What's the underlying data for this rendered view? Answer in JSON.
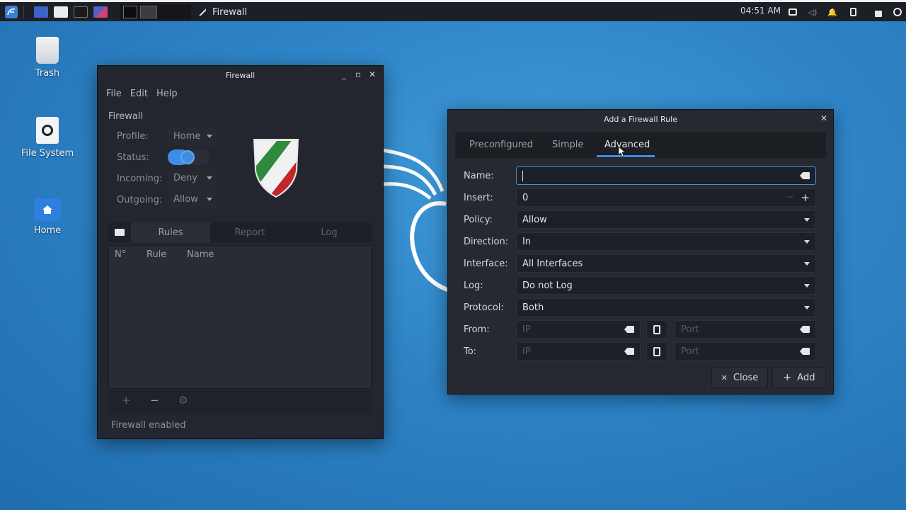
{
  "panel": {
    "active_task": "Firewall",
    "clock": "04:51 AM"
  },
  "desktop": {
    "icons": [
      {
        "label": "Trash"
      },
      {
        "label": "File System"
      },
      {
        "label": "Home"
      }
    ]
  },
  "firewall_window": {
    "title": "Firewall",
    "menu": [
      "File",
      "Edit",
      "Help"
    ],
    "section_title": "Firewall",
    "profile_label": "Profile:",
    "profile_value": "Home",
    "status_label": "Status:",
    "status_on": true,
    "incoming_label": "Incoming:",
    "incoming_value": "Deny",
    "outgoing_label": "Outgoing:",
    "outgoing_value": "Allow",
    "tabs": [
      "Rules",
      "Report",
      "Log"
    ],
    "columns": [
      "N°",
      "Rule",
      "Name"
    ],
    "add_symbol": "+",
    "remove_symbol": "−",
    "status_bar": "Firewall enabled"
  },
  "dialog": {
    "title": "Add a Firewall Rule",
    "tabs": [
      "Preconfigured",
      "Simple",
      "Advanced"
    ],
    "active_tab": "Advanced",
    "name_label": "Name:",
    "name_value": "",
    "insert_label": "Insert:",
    "insert_value": "0",
    "insert_minus": "−",
    "insert_plus": "+",
    "policy_label": "Policy:",
    "policy_value": "Allow",
    "direction_label": "Direction:",
    "direction_value": "In",
    "interface_label": "Interface:",
    "interface_value": "All Interfaces",
    "log_label": "Log:",
    "log_value": "Do not Log",
    "protocol_label": "Protocol:",
    "protocol_value": "Both",
    "from_label": "From:",
    "to_label": "To:",
    "ip_placeholder": "IP",
    "port_placeholder": "Port",
    "close_label": "Close",
    "add_label": "Add"
  },
  "colors": {
    "accent": "#3d8fe6",
    "window_bg": "#23262e",
    "panel_bg": "#1c1f26",
    "desktop_bg": "#2f85c8"
  }
}
